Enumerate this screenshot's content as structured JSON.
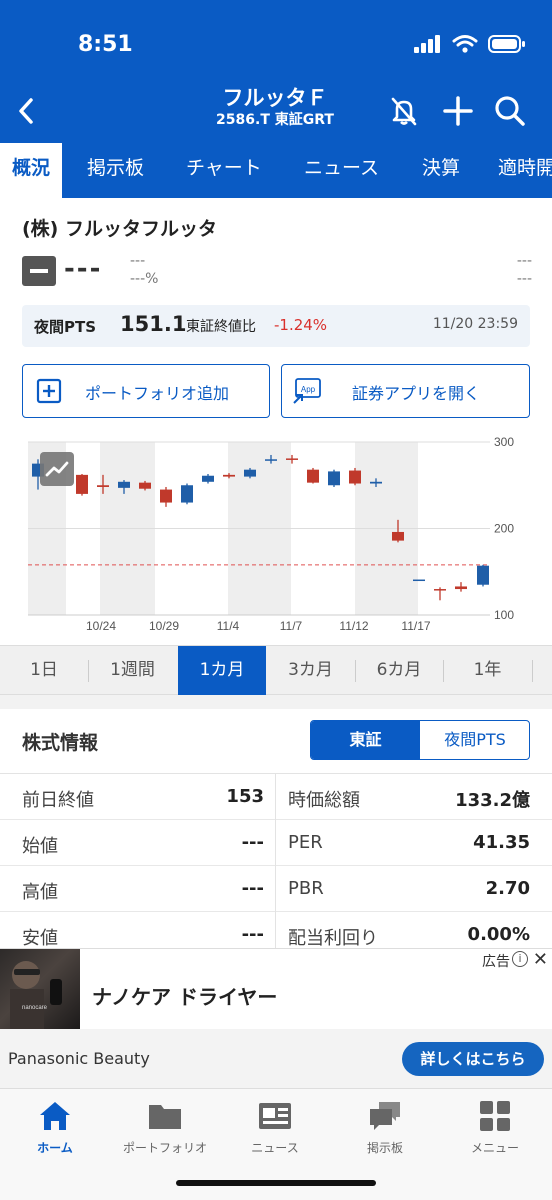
{
  "status_bar": {
    "time": "8:51"
  },
  "header": {
    "title": "フルッタＦ",
    "subtitle": "2586.T 東証GRT",
    "icons": [
      "back-chevron-icon",
      "bell-off-icon",
      "plus-icon",
      "search-icon"
    ]
  },
  "tabs": [
    "概況",
    "掲示板",
    "チャート",
    "ニュース",
    "決算",
    "適時開"
  ],
  "stock": {
    "company": "(株) フルッタフルッタ",
    "price": "---",
    "change": "---",
    "change_pct": "---%",
    "right_top": "---",
    "right_bottom": "---"
  },
  "pts": {
    "label": "夜間PTS",
    "price": "151.1",
    "compare_label": "東証終値比",
    "compare_pct": "-1.24%",
    "time": "11/20 23:59"
  },
  "actions": {
    "portfolio_add": "ポートフォリオ追加",
    "open_app": "証券アプリを開く",
    "app_icon_text": "App"
  },
  "chart_data": {
    "type": "candlestick",
    "y_ticks": [
      "300",
      "200",
      "100"
    ],
    "ylim": [
      100,
      300
    ],
    "x_tick_labels": [
      "10/24",
      "10/29",
      "11/4",
      "11/7",
      "11/12",
      "11/17"
    ],
    "reference_line": 158,
    "colors": {
      "up": "#1f5ea8",
      "down": "#c0392b",
      "ref": "#e05050"
    },
    "candles": [
      {
        "open": 260,
        "close": 275,
        "high": 280,
        "low": 245,
        "dir": "up"
      },
      {
        "open": 262,
        "close": 240,
        "high": 263,
        "low": 238,
        "dir": "down"
      },
      {
        "open": 250,
        "close": 248,
        "high": 262,
        "low": 240,
        "dir": "down"
      },
      {
        "open": 247,
        "close": 254,
        "high": 256,
        "low": 240,
        "dir": "up"
      },
      {
        "open": 253,
        "close": 246,
        "high": 255,
        "low": 244,
        "dir": "down"
      },
      {
        "open": 245,
        "close": 230,
        "high": 248,
        "low": 225,
        "dir": "down"
      },
      {
        "open": 230,
        "close": 250,
        "high": 252,
        "low": 228,
        "dir": "up"
      },
      {
        "open": 254,
        "close": 261,
        "high": 263,
        "low": 252,
        "dir": "up"
      },
      {
        "open": 262,
        "close": 260,
        "high": 264,
        "low": 258,
        "dir": "down"
      },
      {
        "open": 260,
        "close": 268,
        "high": 270,
        "low": 258,
        "dir": "up"
      },
      {
        "open": 280,
        "close": 280,
        "high": 285,
        "low": 275,
        "dir": "up"
      },
      {
        "open": 281,
        "close": 280,
        "high": 285,
        "low": 275,
        "dir": "down"
      },
      {
        "open": 268,
        "close": 253,
        "high": 270,
        "low": 252,
        "dir": "down"
      },
      {
        "open": 250,
        "close": 266,
        "high": 268,
        "low": 248,
        "dir": "up"
      },
      {
        "open": 267,
        "close": 252,
        "high": 270,
        "low": 250,
        "dir": "down"
      },
      {
        "open": 252,
        "close": 254,
        "high": 258,
        "low": 248,
        "dir": "up"
      },
      {
        "open": 196,
        "close": 186,
        "high": 210,
        "low": 184,
        "dir": "down"
      },
      {
        "open": 141,
        "close": 141,
        "high": 141,
        "low": 141,
        "dir": "up"
      },
      {
        "open": 130,
        "close": 130,
        "high": 132,
        "low": 117,
        "dir": "down"
      },
      {
        "open": 133,
        "close": 130,
        "high": 138,
        "low": 127,
        "dir": "down"
      },
      {
        "open": 135,
        "close": 157,
        "high": 158,
        "low": 133,
        "dir": "up"
      }
    ]
  },
  "periods": [
    "1日",
    "1週間",
    "1カ月",
    "3カ月",
    "6カ月",
    "1年"
  ],
  "active_period": "1カ月",
  "stock_info": {
    "title": "株式情報",
    "seg_on": "東証",
    "seg_off": "夜間PTS",
    "rows": [
      {
        "l_label": "前日終値",
        "l_value": "153",
        "r_label": "時価総額",
        "r_value": "133.2億"
      },
      {
        "l_label": "始値",
        "l_value": "---",
        "r_label": "PER",
        "r_value": "41.35"
      },
      {
        "l_label": "高値",
        "l_value": "---",
        "r_label": "PBR",
        "r_value": "2.70"
      },
      {
        "l_label": "安値",
        "l_value": "---",
        "r_label": "配当利回り",
        "r_value": "0.00%"
      }
    ]
  },
  "ad": {
    "label": "広告",
    "title": "ナノケア ドライヤー",
    "brand": "Panasonic Beauty",
    "cta": "詳しくはこちら",
    "image_text": "nanocare"
  },
  "bottom_nav": [
    {
      "label": "ホーム",
      "icon": "home-icon",
      "active": true
    },
    {
      "label": "ポートフォリオ",
      "icon": "folder-icon",
      "active": false
    },
    {
      "label": "ニュース",
      "icon": "newspaper-icon",
      "active": false
    },
    {
      "label": "掲示板",
      "icon": "chat-bubbles-icon",
      "active": false
    },
    {
      "label": "メニュー",
      "icon": "grid-icon",
      "active": false
    }
  ]
}
